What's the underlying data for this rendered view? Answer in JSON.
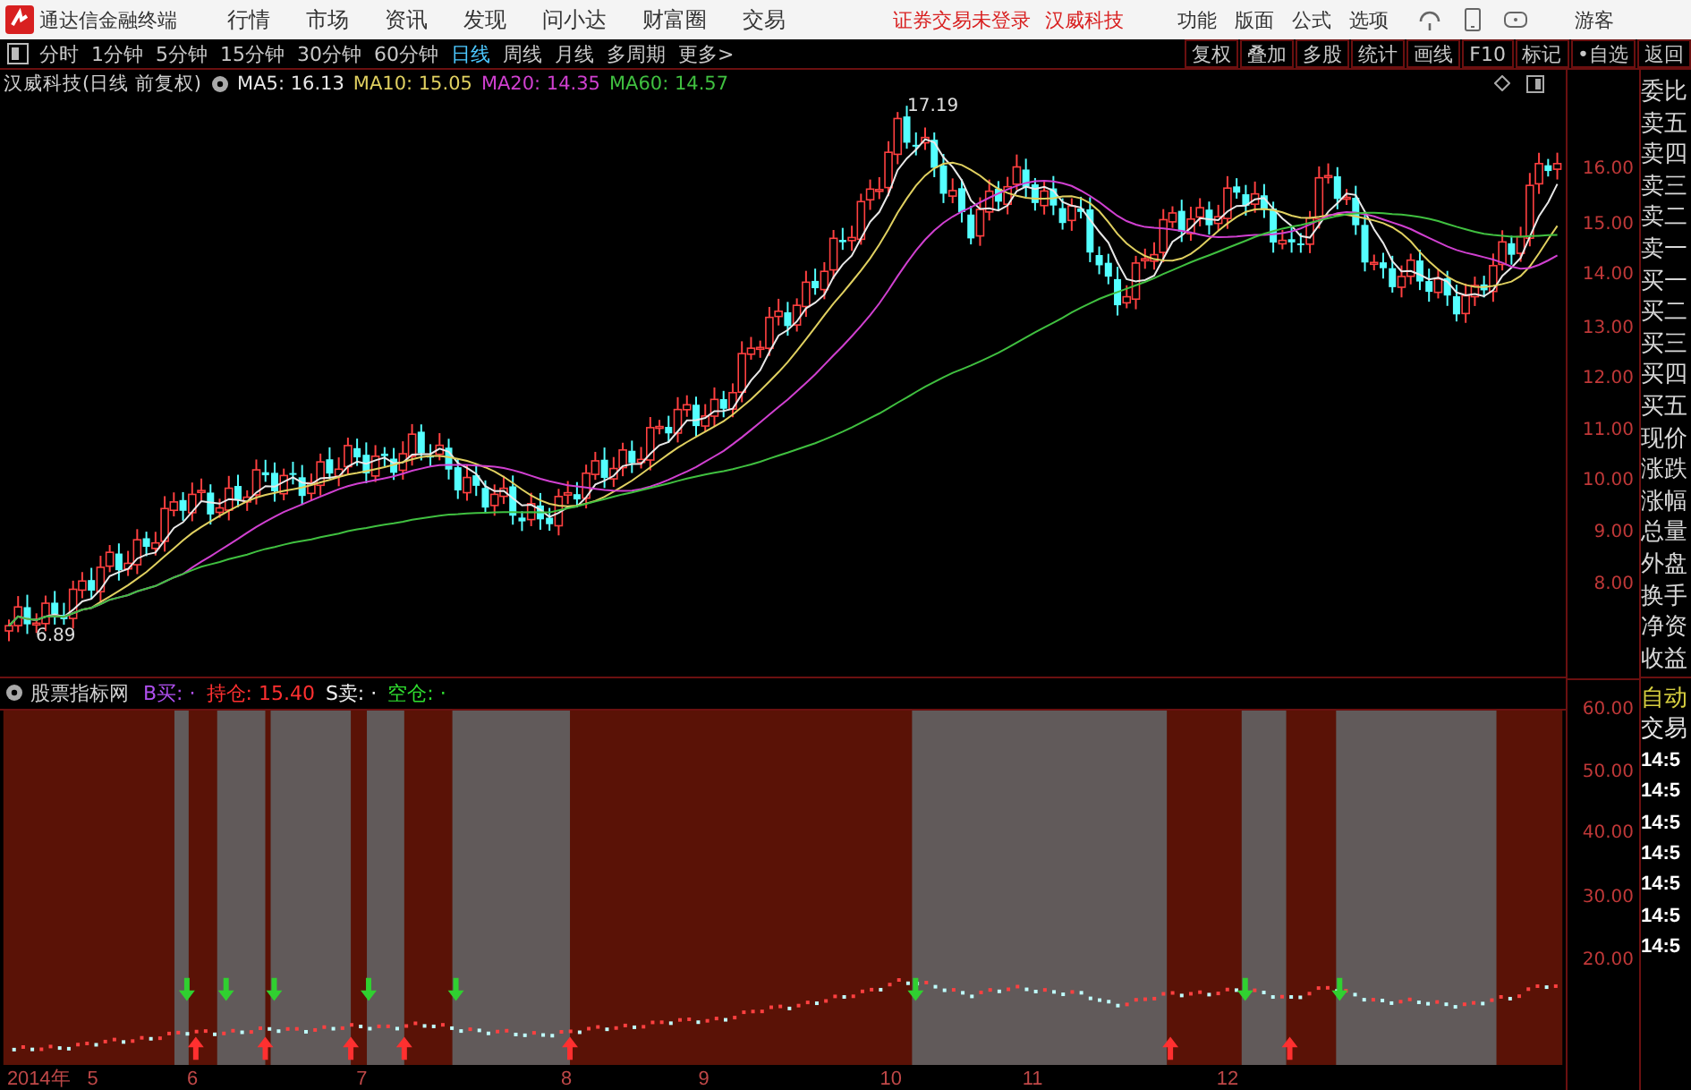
{
  "title_bar": {
    "app_name": "通达信金融终端",
    "menu": [
      "行情",
      "市场",
      "资讯",
      "发现",
      "问小达",
      "财富圈",
      "交易"
    ],
    "notices": [
      "证券交易未登录",
      "汉威科技"
    ],
    "right_menu": [
      "功能",
      "版面",
      "公式",
      "选项"
    ],
    "user": "游客"
  },
  "period_tabs": [
    {
      "label": "分时",
      "selected": false
    },
    {
      "label": "1分钟",
      "selected": false
    },
    {
      "label": "5分钟",
      "selected": false
    },
    {
      "label": "15分钟",
      "selected": false
    },
    {
      "label": "30分钟",
      "selected": false
    },
    {
      "label": "60分钟",
      "selected": false
    },
    {
      "label": "日线",
      "selected": true
    },
    {
      "label": "周线",
      "selected": false
    },
    {
      "label": "月线",
      "selected": false
    },
    {
      "label": "多周期",
      "selected": false
    },
    {
      "label": "更多>",
      "selected": false
    }
  ],
  "tools": [
    "复权",
    "叠加",
    "多股",
    "统计",
    "画线",
    "F10",
    "标记",
    "•自选",
    "返回"
  ],
  "price_panel": {
    "title": "汉威科技(日线 前复权)",
    "ma": [
      {
        "label": "MA5: 16.13",
        "color": "#e8e8e8"
      },
      {
        "label": "MA10: 15.05",
        "color": "#e0d060"
      },
      {
        "label": "MA20: 14.35",
        "color": "#d040d0"
      },
      {
        "label": "MA60: 14.57",
        "color": "#40c040"
      }
    ],
    "high_label": "17.19",
    "low_label": "6.89",
    "y_labels": [
      "16.00",
      "15.00",
      "14.00",
      "13.00",
      "12.00",
      "11.00",
      "10.00",
      "9.00",
      "8.00"
    ]
  },
  "quote_sidebar": [
    "委比",
    "卖五",
    "卖四",
    "卖三",
    "卖二",
    "卖一",
    "买一",
    "买二",
    "买三",
    "买四",
    "买五",
    "现价",
    "涨跌",
    "涨幅",
    "总量",
    "外盘",
    "换手",
    "净资",
    "收益"
  ],
  "indicator_panel": {
    "title": "股票指标网",
    "signals": [
      {
        "label": "B买:",
        "value": "·",
        "color": "#b050f0"
      },
      {
        "label": "持仓:",
        "value": "15.40",
        "color": "#ff3030"
      },
      {
        "label": "S卖:",
        "value": "·",
        "color": "#f0f0f0"
      },
      {
        "label": "空仓:",
        "value": "·",
        "color": "#30e030"
      }
    ],
    "y_labels": [
      "60.00",
      "50.00",
      "40.00",
      "30.00",
      "20.00"
    ]
  },
  "trade_sidebar": [
    {
      "text": "自动",
      "kind": "mode"
    },
    {
      "text": "交易",
      "kind": "label"
    },
    {
      "text": "14:5",
      "kind": "time"
    },
    {
      "text": "14:5",
      "kind": "time"
    },
    {
      "text": "14:5",
      "kind": "time"
    },
    {
      "text": "14:5",
      "kind": "time"
    },
    {
      "text": "14:5",
      "kind": "time"
    },
    {
      "text": "14:5",
      "kind": "time"
    },
    {
      "text": "14:5",
      "kind": "time"
    }
  ],
  "x_axis": [
    "2014年",
    "5",
    "6",
    "7",
    "8",
    "9",
    "10",
    "11",
    "12"
  ]
}
